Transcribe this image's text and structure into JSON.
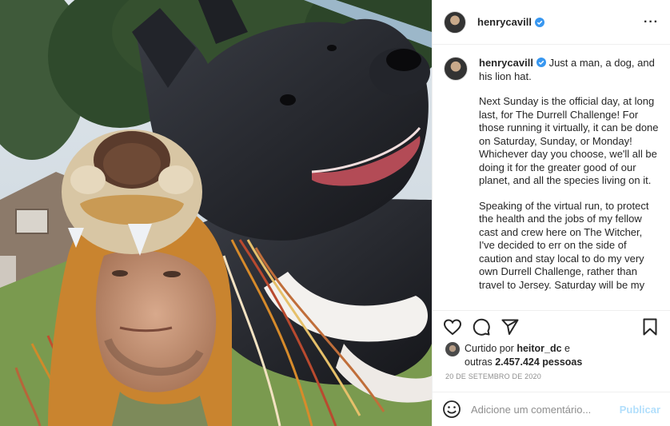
{
  "header": {
    "username": "henrycavill",
    "more_label": "···"
  },
  "caption": {
    "username": "henrycavill",
    "paragraphs": [
      "Just a man, a dog, and his lion hat.",
      "Next Sunday is the official day, at long last, for The Durrell Challenge! For those running it virtually, it can be done on Saturday, Sunday, or Monday! Whichever day you choose, we'll all be doing it for the greater good of our planet, and all the species living on it.",
      "Speaking of the virtual run, to protect the health and the jobs of my fellow cast and crew here on The Witcher, I've decided to err on the side of caution and stay local to do my very own Durrell Challenge, rather than travel to Jersey. Saturday will be my"
    ]
  },
  "actions": {
    "like_icon": "heart-icon",
    "comment_icon": "comment-icon",
    "share_icon": "paper-plane-icon",
    "save_icon": "bookmark-icon"
  },
  "likes": {
    "prefix": "Curtido por ",
    "user": "heitor_dc",
    "middle": " e",
    "others_prefix": "outras ",
    "others_count": "2.457.424 pessoas"
  },
  "date": "20 DE SETEMBRO DE 2020",
  "comment": {
    "placeholder": "Adicione um comentário...",
    "post_label": "Publicar"
  },
  "colors": {
    "verified": "#3897f0",
    "post_disabled": "#b2dffc",
    "muted": "#8e8e8e"
  }
}
